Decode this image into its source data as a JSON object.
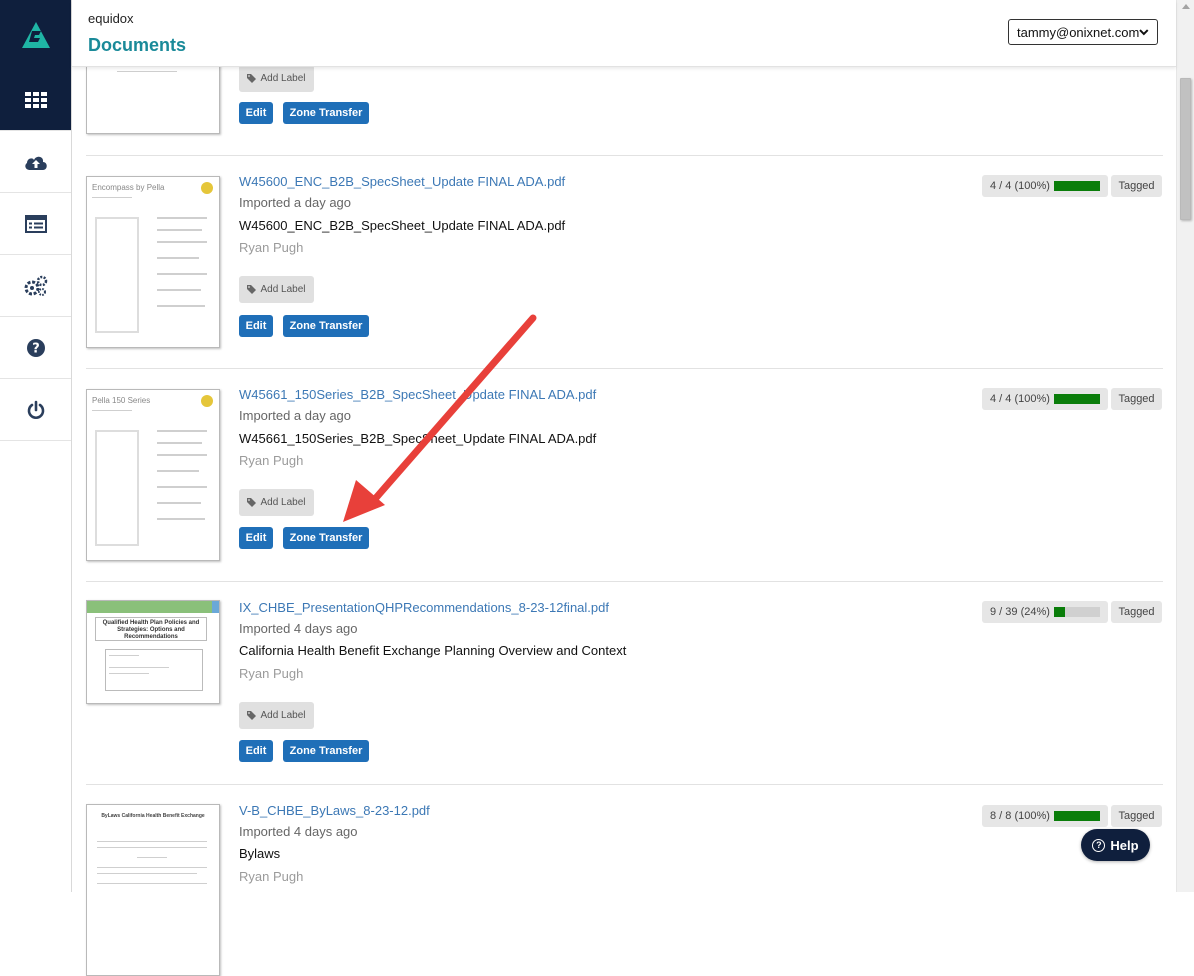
{
  "app": {
    "brand": "equidox",
    "page_title": "Documents"
  },
  "user": {
    "email": "tammy@onixnet.com"
  },
  "sidebar": {
    "items": [
      {
        "name": "dashboard",
        "icon": "grid-icon"
      },
      {
        "name": "upload",
        "icon": "cloud-upload-icon"
      },
      {
        "name": "list",
        "icon": "list-icon"
      },
      {
        "name": "settings",
        "icon": "gears-icon"
      },
      {
        "name": "help",
        "icon": "question-icon"
      },
      {
        "name": "logout",
        "icon": "power-icon"
      }
    ]
  },
  "actions": {
    "add_label": "Add Label",
    "edit": "Edit",
    "zone_transfer": "Zone Transfer"
  },
  "documents": [
    {
      "filename": "",
      "imported": "",
      "title": "",
      "owner": ""
    },
    {
      "filename": "W45600_ENC_B2B_SpecSheet_Update FINAL ADA.pdf",
      "imported": "Imported a day ago",
      "title": "W45600_ENC_B2B_SpecSheet_Update FINAL ADA.pdf",
      "owner": "Ryan Pugh",
      "progress_text": "4 / 4 (100%)",
      "progress": 1.0,
      "status": "Tagged",
      "thumb_heading": "Encompass by Pella"
    },
    {
      "filename": "W45661_150Series_B2B_SpecSheet_Update FINAL ADA.pdf",
      "imported": "Imported a day ago",
      "title": "W45661_150Series_B2B_SpecSheet_Update FINAL ADA.pdf",
      "owner": "Ryan Pugh",
      "progress_text": "4 / 4 (100%)",
      "progress": 1.0,
      "status": "Tagged",
      "thumb_heading": "Pella 150 Series"
    },
    {
      "filename": "IX_CHBE_PresentationQHPRecommendations_8-23-12final.pdf",
      "imported": "Imported 4 days ago",
      "title": "California Health Benefit Exchange Planning Overview and Context",
      "owner": "Ryan Pugh",
      "progress_text": "9 / 39 (24%)",
      "progress": 0.24,
      "status": "Tagged",
      "thumb_heading": "Qualified Health Plan Policies and Strategies: Options and Recommendations"
    },
    {
      "filename": "V-B_CHBE_ByLaws_8-23-12.pdf",
      "imported": "Imported 4 days ago",
      "title": "Bylaws",
      "owner": "Ryan Pugh",
      "progress_text": "8 / 8 (100%)",
      "progress": 1.0,
      "status": "Tagged",
      "thumb_heading": "ByLaws California Health Benefit Exchange"
    }
  ],
  "help": {
    "label": "Help"
  },
  "colors": {
    "nav_dark": "#0f1f3d",
    "accent_teal": "#1a8a99",
    "button_blue": "#1f6fb8",
    "progress_green": "#0a7d0a",
    "arrow_red": "#e8403a"
  }
}
